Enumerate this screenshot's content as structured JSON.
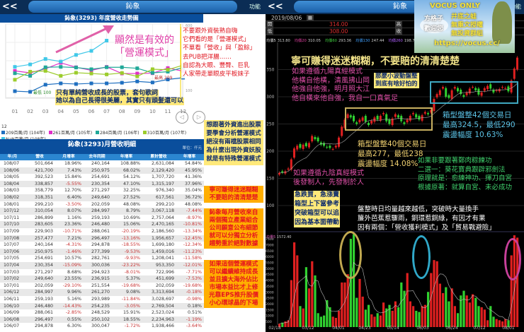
{
  "left_panel": {
    "back_label": "<<",
    "title": "鈊象",
    "function_label": "功能",
    "chart_title": "鈊象(3293) 年度營收走勢圖",
    "table_title": "鈊象(3293)月營收明細",
    "unit": "單位：仟元",
    "chart_nav": {
      "prev": "◁",
      "next": "▷"
    },
    "legend_year_label": "12",
    "annotation_pink": [
      "顯然是有效的",
      "「營運模式」"
    ],
    "annotation_red": [
      "不要跟外資裝熟自嗨",
      "它們看的是「營運模式」",
      "不單看「營收」與「盈餘」",
      "去PUB把洋腸……",
      "自認為大眼、豐臀、巨乳",
      "人家帶走單眼皮平板妹子"
    ],
    "annotation_yellow": [
      "只有單純營收成長的股票，套句歌詞",
      "她以為自己長得很美麗，其實只有頭髮還可以"
    ],
    "box_foreign": [
      "想跟著外資進出股票",
      "要學會分析營運模式",
      "絕沒有兩檔股票相同",
      "為什麼出現外資妖股",
      "就是有特殊營運模式"
    ],
    "box_orange_1": [
      "寧可賺得迷迷糊糊",
      "不要賠的清清楚楚"
    ],
    "box_orange_2": [
      "鈊象每月營收來自",
      "兩個獨立產業組合",
      "公司願意公布細節",
      "就可以分獨立分析",
      "趨勢重於絕對數據"
    ],
    "box_orange_3": [
      "如果這個營運模式",
      "可以繼續維持成長",
      "並且擴大海外佔比",
      "市場本益比才上修",
      "光靠EPS推升股價",
      "小心環球晶的下場"
    ],
    "table": {
      "headers": [
        "年/月",
        "營收",
        "月增率",
        "去年同期",
        "年增率",
        "累計營收",
        "年增率"
      ],
      "rows": [
        [
          "108/07",
          "501,664",
          "18.96%",
          "240,164",
          "108.88%",
          "2,631,084",
          "54.84%"
        ],
        [
          "108/06",
          "421,700",
          "7.43%",
          "250,975",
          "68.02%",
          "2,129,420",
          "45.95%"
        ],
        [
          "108/05",
          "392,523",
          "15.84%",
          "254,691",
          "54.12%",
          "1,707,720",
          "41.36%"
        ],
        [
          "108/04",
          "338,857",
          "-5.55%",
          "230,354",
          "47.10%",
          "1,315,197",
          "37.96%"
        ],
        [
          "108/03",
          "358,779",
          "12.70%",
          "271,297",
          "32.25%",
          "976,340",
          "35.04%"
        ],
        [
          "108/02",
          "318,351",
          "6.40%",
          "249,640",
          "27.52%",
          "617,561",
          "36.72%"
        ],
        [
          "108/01",
          "299,210",
          "-3.50%",
          "202,059",
          "48.08%",
          "299,210",
          "48.08%"
        ],
        [
          "107/12",
          "310,054",
          "8.07%",
          "284,997",
          "8.79%",
          "3,067,118",
          "-7.44%"
        ],
        [
          "107/11",
          "286,899",
          "1.16%",
          "259,193",
          "10.69%",
          "2,757,064",
          "-8.97%"
        ],
        [
          "107/10",
          "283,605",
          "23.36%",
          "246,480",
          "15.06%",
          "2,470,165",
          "-10.81%"
        ],
        [
          "107/09",
          "229,903",
          "-10.71%",
          "288,061",
          "-20.19%",
          "2,186,560",
          "-13.34%"
        ],
        [
          "107/08",
          "257,477",
          "7.21%",
          "296,497",
          "-13.16%",
          "1,956,657",
          "-12.45%"
        ],
        [
          "107/07",
          "240,164",
          "-4.31%",
          "294,878",
          "-18.55%",
          "1,699,180",
          "-12.34%"
        ],
        [
          "107/06",
          "250,975",
          "-1.46%",
          "277,399",
          "-9.53%",
          "1,459,016",
          "-11.23%"
        ],
        [
          "107/05",
          "254,691",
          "10.57%",
          "282,761",
          "-9.93%",
          "1,208,041",
          "-11.58%"
        ],
        [
          "107/04",
          "230,354",
          "-15.09%",
          "300,036",
          "-23.22%",
          "953,350",
          "-12.01%"
        ],
        [
          "107/03",
          "271,297",
          "8.68%",
          "294,923",
          "-8.01%",
          "722,996",
          "-7.71%"
        ],
        [
          "107/02",
          "249,640",
          "23.55%",
          "236,915",
          "5.37%",
          "451,699",
          "-7.53%"
        ],
        [
          "107/01",
          "202,059",
          "-29.10%",
          "251,554",
          "-19.68%",
          "202,059",
          "-19.68%"
        ],
        [
          "106/12",
          "284,997",
          "9.96%",
          "261,270",
          "9.08%",
          "3,313,694",
          "-0.18%"
        ],
        [
          "106/11",
          "259,193",
          "5.16%",
          "293,989",
          "-11.84%",
          "3,028,697",
          "-0.98%"
        ],
        [
          "106/10",
          "246,480",
          "-14.43%",
          "254,235",
          "-3.05%",
          "2,769,504",
          "0.18%"
        ],
        [
          "106/09",
          "288,061",
          "-2.85%",
          "248,529",
          "15.91%",
          "2,523,024",
          "0.51%"
        ],
        [
          "106/08",
          "296,497",
          "0.55%",
          "250,102",
          "18.55%",
          "2,234,963",
          "-1.19%"
        ],
        [
          "106/07",
          "294,878",
          "6.30%",
          "300,047",
          "-1.72%",
          "1,938,466",
          "-3.64%"
        ]
      ]
    }
  },
  "right_panel": {
    "back_label": "<<",
    "title": "鈊象",
    "function_label": "功能",
    "date": "2019/08/06",
    "open_label": "開",
    "open": "314.00",
    "low_label": "低",
    "low": "308.00",
    "high_label": "高",
    "close_label": "收",
    "ma": [
      {
        "label": "均價5",
        "value": "313.80",
        "color": "#e0e0e0"
      },
      {
        "label": "均價20",
        "value": "310.05",
        "color": "#e040a0"
      },
      {
        "label": "均價60",
        "value": "293.36",
        "color": "#40d040"
      },
      {
        "label": "均價130",
        "value": "247.44",
        "color": "#40a0ff"
      },
      {
        "label": "均價260",
        "value": "198.77",
        "color": "#b060ff"
      }
    ],
    "volume_ma": {
      "label": "均量5",
      "value": "1572.40"
    },
    "banner": {
      "line1": "VOCUS ONLY",
      "welcome": [
        "方格子",
        "歡迎您"
      ],
      "lines": [
        "井底之蛙",
        "無重文授權",
        "無投資群組",
        "https://vocus.cc/"
      ]
    },
    "headline": "寧可賺得迷迷糊糊，不要賠的清清楚楚",
    "pink_text_1": [
      "如果遵循九陽真經模式",
      "他橫自他橫，清風拂山岡",
      "他強自他強，明月照大江",
      "他自橫來他自強，我自一口真氣足"
    ],
    "yellow_box_small": [
      "那麼小波動盤整",
      "到底有啥好怕的"
    ],
    "cyan_text": [
      "箱型盤整42個交易日",
      "最高324.5，最低290",
      "震盪幅度 10.63%"
    ],
    "gold_text": [
      "箱型盤整40個交易日",
      "最高277，最低238",
      "震盪幅度 14.08%"
    ],
    "green_text": [
      "如果非要跟著鄭肉粽練功",
      "二選一：葵花寶典跟辟邪劍法",
      "原理就是：愈練神功、揮刀自宮",
      "根據原著：就算自宮、未必成功"
    ],
    "pink_text_2": [
      "如果遵循九陰真經模式",
      "後發制人，先發制於人"
    ],
    "yellow_box_big": [
      "急跌買，急漲賣",
      "箱型上下當參考",
      "突破箱型可以追",
      "因為基本面帶動"
    ],
    "white_text": [
      "盤整時日均量越來越低，突破時大量換手",
      "簾外芭蕉惹驟雨，銅環惹銅綠，有因才有果",
      "因有兩個：「營收獲利模式」及「貿易戰避險」"
    ]
  },
  "chart_data": [
    {
      "type": "line",
      "title": "鈊象(3293) 年度營收走勢圖",
      "categories": [
        "01",
        "02",
        "03",
        "04",
        "05",
        "06",
        "07",
        "08",
        "09",
        "10",
        "11",
        "12"
      ],
      "ylim": [
        100,
        600
      ],
      "y_ticks": [
        "600",
        "100"
      ],
      "max_label": "最高 209",
      "min_label": "最低 100",
      "series": [
        {
          "name": "209百萬/月 (104年)",
          "color": "#1f6fc0",
          "values": [
            105,
            100,
            155,
            165,
            160,
            165,
            165,
            170,
            180,
            172,
            195,
            209
          ]
        },
        {
          "name": "261百萬/月 (105年)",
          "color": "#e030c8",
          "values": [
            261,
            246,
            278,
            323,
            289,
            265,
            292,
            241,
            241,
            243,
            283,
            259
          ]
        },
        {
          "name": "284百萬/月 (106年)",
          "color": "#20a898",
          "values": [
            243,
            223,
            289,
            292,
            287,
            274,
            289,
            289,
            281,
            246,
            255,
            287
          ]
        },
        {
          "name": "310百萬/月 (107年)",
          "color": "#9ccc2c",
          "values": [
            193,
            255,
            261,
            223,
            247,
            241,
            234,
            245,
            219,
            274,
            270,
            305
          ]
        },
        {
          "name": "NaN百萬/月 (108年)",
          "color": "#40c8e8",
          "values": [
            292,
            311,
            353,
            333,
            384,
            415,
            494
          ]
        }
      ]
    },
    {
      "type": "candlestick",
      "y_ticks": [
        350,
        300,
        250,
        200,
        150,
        100
      ],
      "ylim": [
        80,
        410
      ],
      "closes": [
        160,
        161,
        163,
        168,
        185,
        205,
        210,
        206,
        212,
        209,
        215,
        228,
        222,
        218,
        212,
        210,
        207,
        206,
        204,
        210,
        225,
        245,
        258,
        268,
        262,
        255,
        250,
        258,
        262,
        254,
        248,
        256,
        262,
        258,
        265,
        270,
        255,
        250,
        260,
        268,
        262,
        255,
        250,
        258,
        265,
        270,
        262,
        258,
        266,
        272,
        268,
        276,
        296,
        305,
        312,
        318,
        300,
        298,
        312,
        318,
        310,
        305,
        300,
        308,
        315,
        318,
        312,
        304,
        308,
        316,
        320,
        315,
        308,
        312,
        314,
        318,
        316,
        310,
        330,
        352,
        372
      ]
    },
    {
      "type": "bar",
      "name": "volume",
      "x_ticks": [
        "02/18",
        "03/12",
        "04/01",
        "04/23",
        "05/14",
        "06/03",
        "06/24",
        "07/12",
        "08/01"
      ],
      "y_ticks": [
        7500,
        7000,
        6500,
        6000,
        5500,
        5000,
        4500,
        4000,
        3500,
        3000,
        2500,
        2000,
        1500,
        1000,
        500
      ],
      "ylim": [
        0,
        8000
      ],
      "values": [
        300,
        400,
        500,
        600,
        4000,
        7200,
        6100,
        1800,
        1600,
        5100,
        3300,
        5600,
        4400,
        1200,
        900,
        1000,
        2300,
        1700,
        900,
        800,
        1400,
        3800,
        3800,
        4500,
        7500,
        7900,
        2500,
        4100,
        2600,
        1500,
        1900,
        1100,
        900,
        1200,
        1000,
        2100,
        1600,
        1900,
        1400,
        2200,
        1700,
        3800,
        3100,
        4600,
        2200,
        1800,
        1400,
        1300,
        1800,
        1900,
        3000,
        4600,
        5700,
        5600,
        3700,
        2900,
        3400,
        2200,
        3300,
        1800,
        1200,
        2700,
        3100,
        2700,
        2100,
        2800,
        2500,
        1800,
        1700,
        1500,
        600,
        1800,
        900,
        700,
        600,
        500,
        700,
        600,
        6100,
        7800,
        7600
      ]
    }
  ]
}
